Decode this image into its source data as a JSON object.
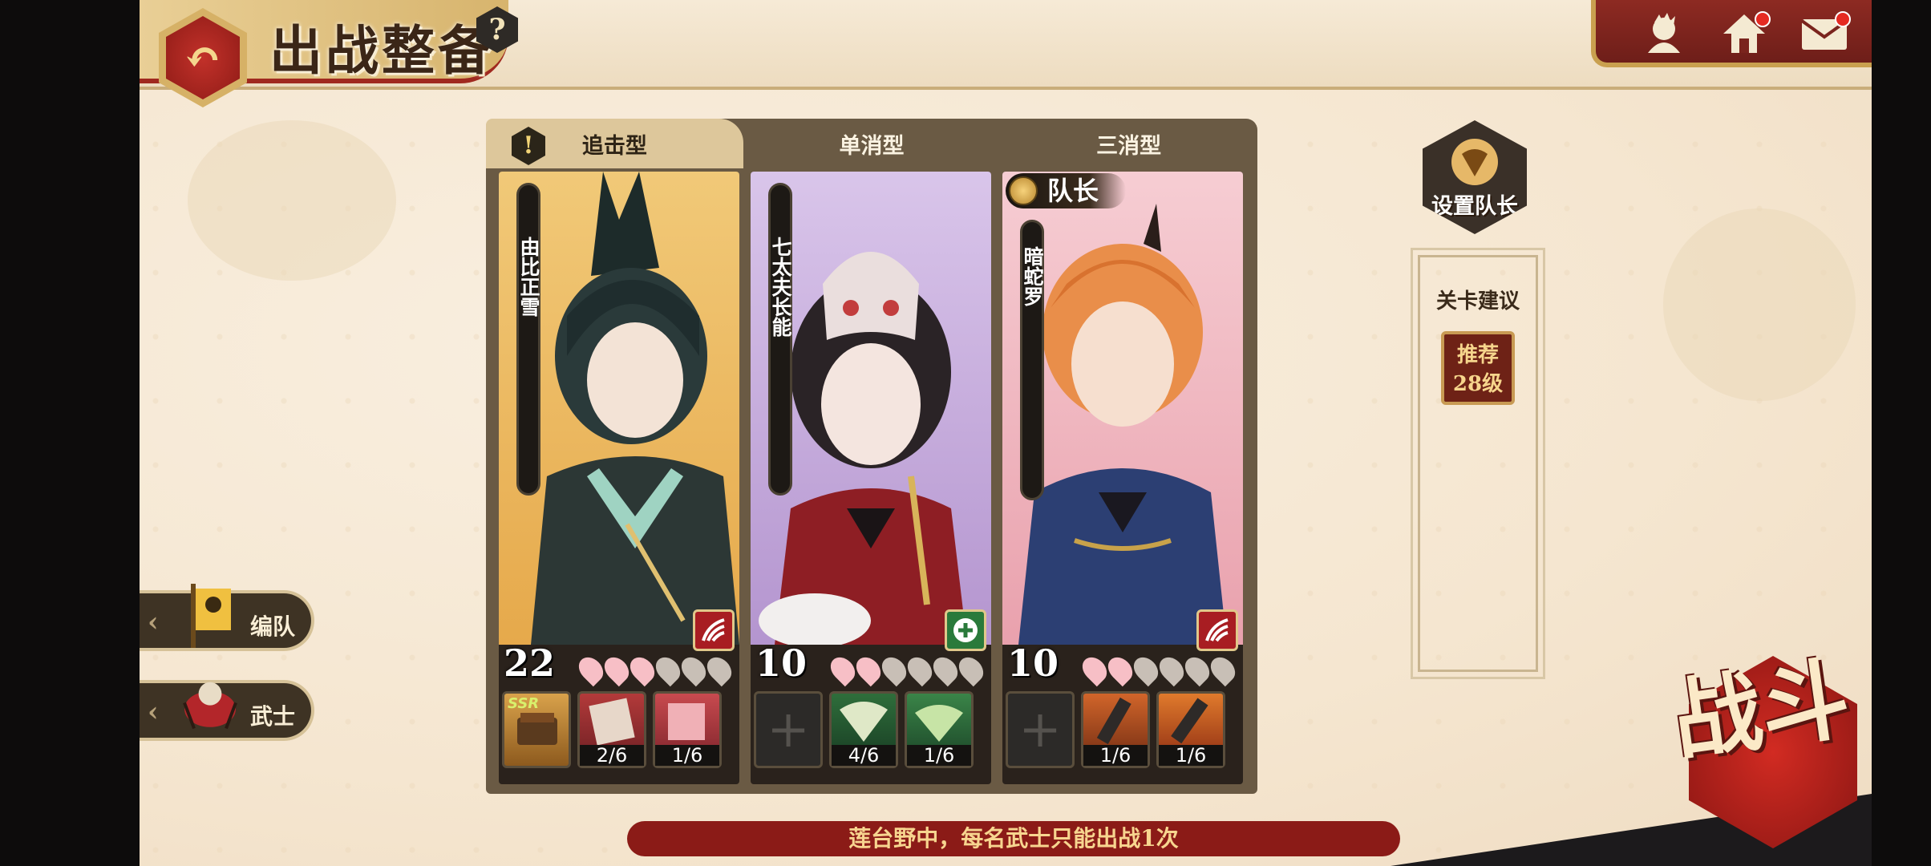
{
  "header": {
    "title": "出战整备",
    "back_icon": "↶",
    "help_label": "?"
  },
  "top_right": {
    "icons": [
      "character-icon",
      "home-icon",
      "mail-icon"
    ]
  },
  "panel": {
    "tabs": [
      "追击型",
      "单消型",
      "三消型"
    ],
    "warn_label": "!",
    "captain_label": "队长",
    "cards": [
      {
        "name": "由比正雪",
        "level": "22",
        "petals_on": 3,
        "petals_total": 6,
        "slots": [
          {
            "type": "ssr",
            "label": "SSR"
          },
          {
            "frac": "2/6"
          },
          {
            "frac": "1/6"
          }
        ],
        "bg": "#efc370",
        "accent": "#a81d22"
      },
      {
        "name": "七太夫长能",
        "level": "10",
        "petals_on": 2,
        "petals_total": 6,
        "slots": [
          {
            "type": "empty"
          },
          {
            "frac": "4/6"
          },
          {
            "frac": "1/6"
          }
        ],
        "bg": "#c4a7d8",
        "accent": "#2a7a3b"
      },
      {
        "name": "暗蛇罗",
        "level": "10",
        "petals_on": 2,
        "petals_total": 6,
        "slots": [
          {
            "type": "empty"
          },
          {
            "frac": "1/6"
          },
          {
            "frac": "1/6"
          }
        ],
        "bg": "#f4c0c8",
        "accent": "#a81d22"
      }
    ]
  },
  "set_captain": {
    "label": "设置队长"
  },
  "advice": {
    "title": "关卡建议",
    "rec_line1": "推荐",
    "rec_line2": "28级"
  },
  "side": {
    "formation": "编队",
    "samurai": "武士"
  },
  "notice": "莲台野中，每名武士只能出战1次",
  "battle": {
    "label": "战斗"
  },
  "colors": {
    "primary_red": "#8b1b17",
    "gold": "#d6b166",
    "panel": "#6a5a44"
  }
}
